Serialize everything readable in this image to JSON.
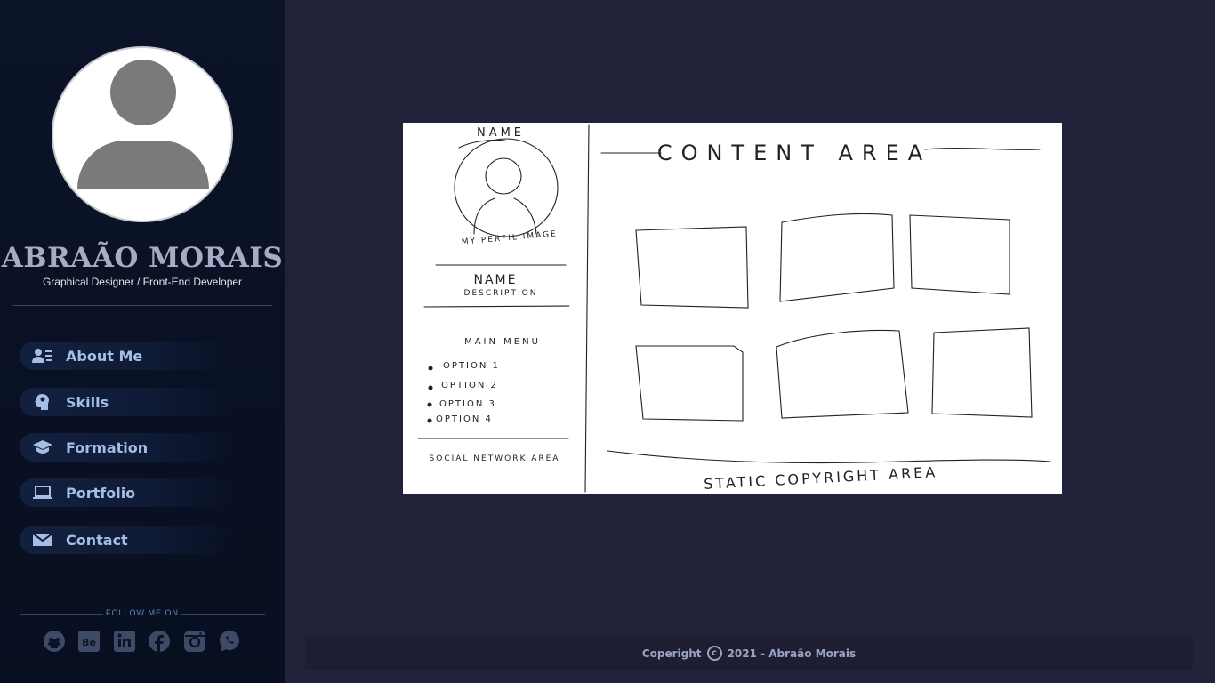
{
  "profile": {
    "name": "ABRAÃO MORAIS",
    "description": "Graphical Designer / Front-End Developer"
  },
  "nav": {
    "items": [
      {
        "label": "About Me",
        "icon": "user-list-icon"
      },
      {
        "label": "Skills",
        "icon": "head-gear-icon"
      },
      {
        "label": "Formation",
        "icon": "graduation-cap-icon"
      },
      {
        "label": "Portfolio",
        "icon": "laptop-icon"
      },
      {
        "label": "Contact",
        "icon": "envelope-icon"
      }
    ]
  },
  "social": {
    "heading": "FOLLOW ME ON",
    "icons": [
      "github-icon",
      "behance-icon",
      "linkedin-icon",
      "facebook-icon",
      "instagram-icon",
      "whatsapp-icon"
    ]
  },
  "sketch": {
    "name_top": "NAME",
    "profile_image_label": "MY PERFIL IMAGE",
    "name_mid": "NAME",
    "description": "DESCRIPTION",
    "main_menu": "MAIN MENU",
    "options": [
      "OPTION 1",
      "OPTION 2",
      "OPTION 3",
      "OPTION 4"
    ],
    "social_area": "SOCIAL NETWORK AREA",
    "content_area": "CONTENT AREA",
    "copyright_area": "STATIC COPYRIGHT AREA"
  },
  "footer": {
    "prefix": "Coperight",
    "suffix": "2021 - Abraão Morais"
  },
  "colors": {
    "sidebar_bg": "#0b1328",
    "page_bg": "#22223a",
    "nav_text": "#a6bde6",
    "name_text": "#a8aac6",
    "icon_gray": "#3e4a66"
  }
}
